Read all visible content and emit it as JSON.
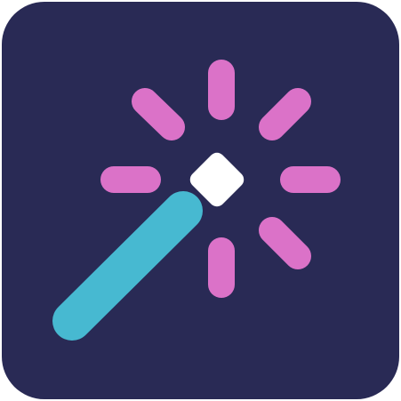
{
  "icon": {
    "name": "magic-wand-icon",
    "colors": {
      "tile": "#292a55",
      "sparkle": "#db72c8",
      "wand_shaft": "#47b9d1",
      "wand_tip": "#ffffff",
      "page_background": "#ffffff"
    }
  }
}
